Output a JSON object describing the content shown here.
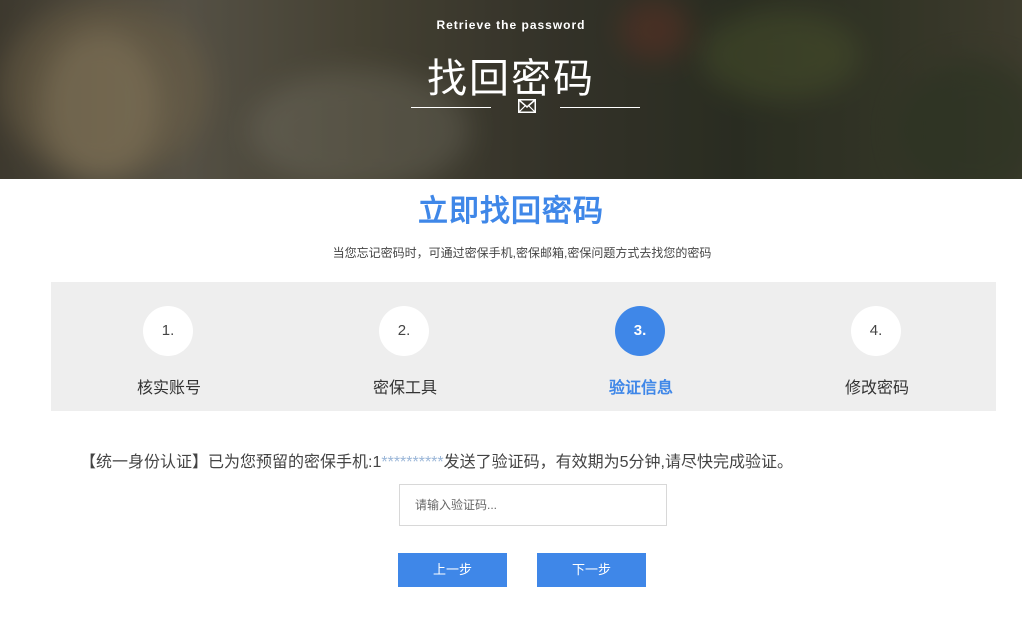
{
  "banner": {
    "subtitle": "Retrieve the password",
    "title": "找回密码",
    "icon": "envelope-icon"
  },
  "main": {
    "title": "立即找回密码",
    "description": "当您忘记密码时，可通过密保手机,密保邮箱,密保问题方式去找您的密码"
  },
  "steps": [
    {
      "number": "1.",
      "label": "核实账号",
      "active": false
    },
    {
      "number": "2.",
      "label": "密保工具",
      "active": false
    },
    {
      "number": "3.",
      "label": "验证信息",
      "active": true
    },
    {
      "number": "4.",
      "label": "修改密码",
      "active": false
    }
  ],
  "message": {
    "prefix": "【统一身份认证】已为您预留的密保手机:1",
    "masked": "**********",
    "suffix": "发送了验证码，有效期为5分钟,请尽快完成验证。"
  },
  "form": {
    "code_placeholder": "请输入验证码...",
    "code_value": ""
  },
  "buttons": {
    "prev_label": "上一步",
    "next_label": "下一步"
  },
  "colors": {
    "accent": "#3f87e8",
    "steps_background": "#eeeeee"
  }
}
